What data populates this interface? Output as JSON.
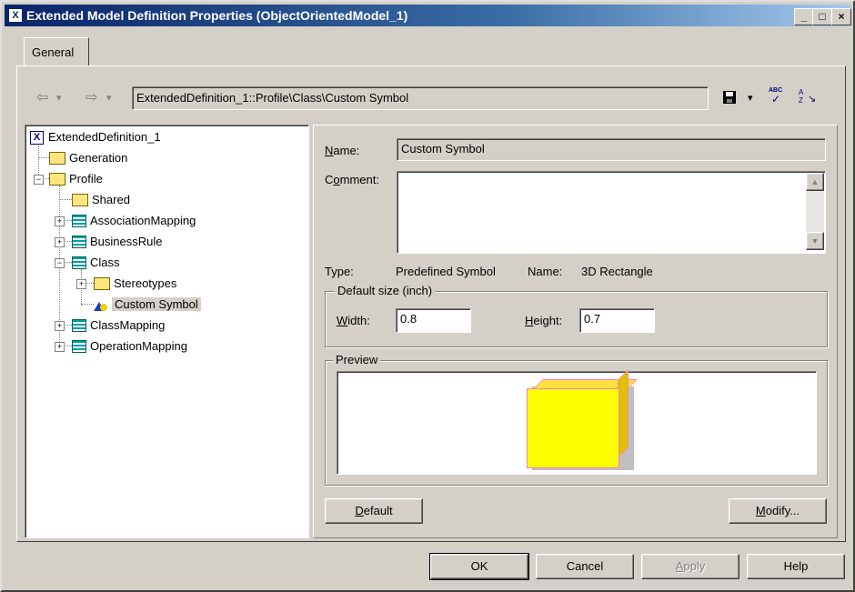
{
  "window": {
    "title": "Extended Model Definition Properties (ObjectOrientedModel_1)",
    "app_icon": "X",
    "minimize": "_",
    "maximize": "□",
    "close": "×"
  },
  "tabs": [
    {
      "label": "General"
    }
  ],
  "nav": {
    "back_icon": "⇦",
    "forward_icon": "⇨",
    "dropdown_icon": "▾",
    "path": "ExtendedDefinition_1::Profile\\Class\\Custom Symbol",
    "save_icon": "save-icon",
    "spell_icon_text": "ABC",
    "sort_icon_text": "A Z"
  },
  "tree": {
    "root": {
      "label": "ExtendedDefinition_1",
      "icon": "X"
    },
    "items": [
      {
        "label": "Generation",
        "icon": "folder"
      },
      {
        "label": "Profile",
        "icon": "folder",
        "expander": "−"
      },
      {
        "label": "Shared",
        "icon": "folder"
      },
      {
        "label": "AssociationMapping",
        "icon": "list",
        "expander": "+"
      },
      {
        "label": "BusinessRule",
        "icon": "list",
        "expander": "+"
      },
      {
        "label": "Class",
        "icon": "list",
        "expander": "−"
      },
      {
        "label": "Stereotypes",
        "icon": "folder",
        "expander": "+"
      },
      {
        "label": "Custom Symbol",
        "icon": "custom-symbol",
        "selected": true
      },
      {
        "label": "ClassMapping",
        "icon": "list",
        "expander": "+"
      },
      {
        "label": "OperationMapping",
        "icon": "list",
        "expander": "+"
      }
    ]
  },
  "properties": {
    "name_label_first": "N",
    "name_label_rest": "ame:",
    "name_value": "Custom Symbol",
    "comment_label_first": "C",
    "comment_label_second": "o",
    "comment_label_rest": "mment:",
    "comment_value": "",
    "scroll_up": "▲",
    "scroll_down": "▼",
    "type_label": "Type:",
    "type_value": "Predefined Symbol",
    "name2_label": "Name:",
    "name2_value": "3D Rectangle",
    "default_size_group": "Default size (inch)",
    "width_label_first": "W",
    "width_label_rest": "idth:",
    "width_value": "0.8",
    "height_label_first": "H",
    "height_label_rest": "eight:",
    "height_value": "0.7",
    "preview_group": "Preview",
    "preview_fill_color": "#ffff00",
    "preview_border_color": "#ff80c0",
    "default_button_first": "D",
    "default_button_rest": "efault",
    "modify_button_first": "M",
    "modify_button_rest": "odify..."
  },
  "footer": {
    "ok": "OK",
    "cancel": "Cancel",
    "apply_first": "A",
    "apply_rest": "pply",
    "help": "Help"
  }
}
